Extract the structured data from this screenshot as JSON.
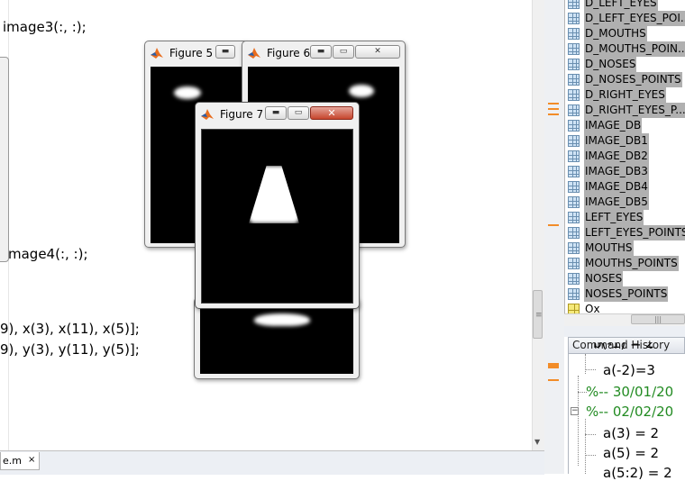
{
  "editor": {
    "lines": [
      "image3(:, :);",
      "mage4(:, :);",
      "9), x(3), x(11), x(5)];",
      "9), y(3), y(11), y(5)];"
    ],
    "tab_label": "e.m",
    "tab_close": "×"
  },
  "figures": {
    "fig5": {
      "title": "Figure 5"
    },
    "fig6": {
      "title": "Figure 6"
    },
    "fig7": {
      "title": "Figure 7"
    }
  },
  "window_buttons": {
    "minimize": "▬",
    "maximize": "▭",
    "close": "✕"
  },
  "workspace": {
    "variables": [
      "D_LEFT_EYES",
      "D_LEFT_EYES_POI...",
      "D_MOUTHS",
      "D_MOUTHS_POIN...",
      "D_NOSES",
      "D_NOSES_POINTS",
      "D_RIGHT_EYES",
      "D_RIGHT_EYES_P...",
      "IMAGE_DB",
      "IMAGE_DB1",
      "IMAGE_DB2",
      "IMAGE_DB3",
      "IMAGE_DB4",
      "IMAGE_DB5",
      "LEFT_EYES",
      "LEFT_EYES_POINTS",
      "MOUTHS",
      "MOUTHS_POINTS",
      "NOSES",
      "NOSES_POINTS",
      "Ox"
    ],
    "scroll_grip": "|||"
  },
  "command_history": {
    "title": "Command History",
    "entries": [
      {
        "text": "a(-2)=3",
        "type": "cmd"
      },
      {
        "text": "%-- 30/01/20",
        "type": "date"
      },
      {
        "text": "%-- 02/02/20",
        "type": "date"
      },
      {
        "text": "a(3) = 2",
        "type": "cmd"
      },
      {
        "text": "a(5) = 2",
        "type": "cmd"
      },
      {
        "text": "a(5:2) = 2",
        "type": "cmd"
      }
    ]
  },
  "colors": {
    "marker": "#f28c28",
    "date_green": "#228b22",
    "selection_gray": "#b0b0b0"
  }
}
